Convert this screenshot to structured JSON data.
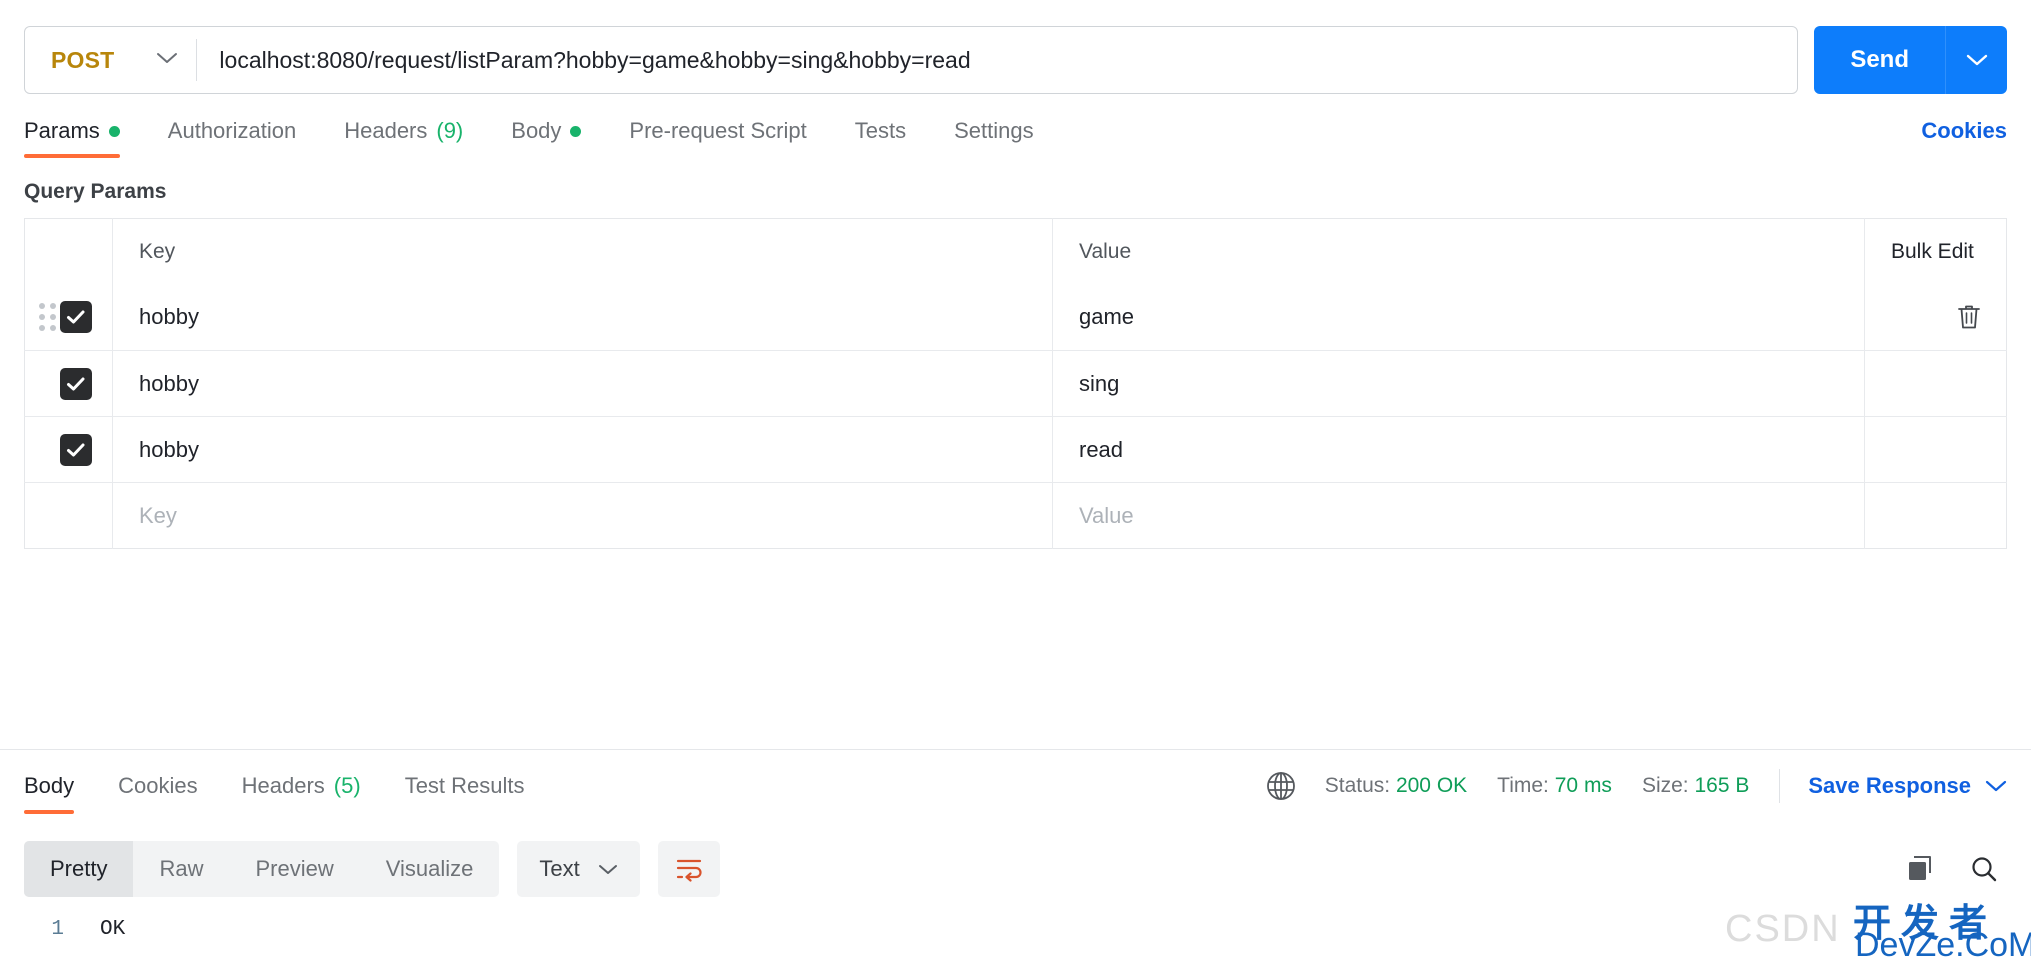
{
  "request": {
    "method": "POST",
    "method_caret_icon": "chevron-down-icon",
    "url": "localhost:8080/request/listParam?hobby=game&hobby=sing&hobby=read",
    "send_label": "Send",
    "send_caret_icon": "chevron-down-icon"
  },
  "request_tabs": [
    {
      "label": "Params",
      "badge": "",
      "dot": true,
      "active": true
    },
    {
      "label": "Authorization",
      "badge": "",
      "dot": false,
      "active": false
    },
    {
      "label": "Headers",
      "badge": "(9)",
      "dot": false,
      "active": false
    },
    {
      "label": "Body",
      "badge": "",
      "dot": true,
      "active": false
    },
    {
      "label": "Pre-request Script",
      "badge": "",
      "dot": false,
      "active": false
    },
    {
      "label": "Tests",
      "badge": "",
      "dot": false,
      "active": false
    },
    {
      "label": "Settings",
      "badge": "",
      "dot": false,
      "active": false
    }
  ],
  "cookies_link": "Cookies",
  "query_params": {
    "title": "Query Params",
    "columns": {
      "key": "Key",
      "value": "Value",
      "bulk_edit": "Bulk Edit"
    },
    "rows": [
      {
        "checked": true,
        "key": "hobby",
        "value": "game",
        "drag_handle": true,
        "trash": true
      },
      {
        "checked": true,
        "key": "hobby",
        "value": "sing",
        "drag_handle": false,
        "trash": false
      },
      {
        "checked": true,
        "key": "hobby",
        "value": "read",
        "drag_handle": false,
        "trash": false
      }
    ],
    "empty_row": {
      "key_placeholder": "Key",
      "value_placeholder": "Value"
    }
  },
  "response_tabs": [
    {
      "label": "Body",
      "badge": "",
      "active": true
    },
    {
      "label": "Cookies",
      "badge": "",
      "active": false
    },
    {
      "label": "Headers",
      "badge": "(5)",
      "active": false
    },
    {
      "label": "Test Results",
      "badge": "",
      "active": false
    }
  ],
  "response_meta": {
    "globe_icon": "globe-icon",
    "status_label": "Status:",
    "status_value": "200 OK",
    "time_label": "Time:",
    "time_value": "70 ms",
    "size_label": "Size:",
    "size_value": "165 B",
    "save_response": "Save Response",
    "save_caret_icon": "chevron-down-icon"
  },
  "body_toolbar": {
    "segments": [
      {
        "label": "Pretty",
        "active": true
      },
      {
        "label": "Raw",
        "active": false
      },
      {
        "label": "Preview",
        "active": false
      },
      {
        "label": "Visualize",
        "active": false
      }
    ],
    "format": "Text",
    "format_caret_icon": "chevron-down-icon",
    "wrap_icon": "word-wrap-icon",
    "copy_icon": "copy-icon",
    "search_icon": "search-icon"
  },
  "response_body": {
    "lines": [
      {
        "number": "1",
        "text": "OK"
      }
    ]
  },
  "watermark": {
    "csdn": "CSDN",
    "chinese": "开发者",
    "site": "DevZe.CoM"
  },
  "colors": {
    "accent_orange": "#ff6c37",
    "send_blue": "#0d7dfb",
    "link_blue": "#1060e0",
    "status_green": "#0f9d58",
    "method_amber": "#b8860b"
  }
}
